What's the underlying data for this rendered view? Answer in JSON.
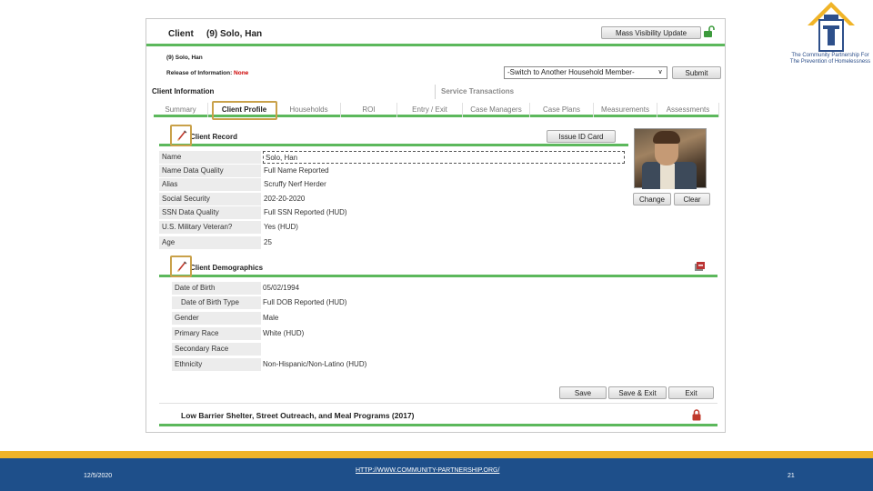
{
  "header": {
    "client_label": "Client",
    "client_name": "(9) Solo, Han",
    "mass_visibility_button": "Mass Visibility Update",
    "sub_name": "(9) Solo, Han",
    "roi_label": "Release of Information:",
    "roi_value": "None",
    "household_select": "-Switch to Another Household Member-",
    "submit_button": "Submit"
  },
  "outer_tabs": [
    {
      "label": "Client Information"
    },
    {
      "label": "Service Transactions"
    }
  ],
  "inner_tabs": [
    {
      "label": "Summary"
    },
    {
      "label": "Client Profile"
    },
    {
      "label": "Households"
    },
    {
      "label": "ROI"
    },
    {
      "label": "Entry / Exit"
    },
    {
      "label": "Case Managers"
    },
    {
      "label": "Case Plans"
    },
    {
      "label": "Measurements"
    },
    {
      "label": "Assessments"
    }
  ],
  "client_record": {
    "title": "Client Record",
    "issue_id_button": "Issue ID Card",
    "rows": [
      {
        "label": "Name",
        "value": "Solo, Han"
      },
      {
        "label": "Name Data Quality",
        "value": "Full Name Reported"
      },
      {
        "label": "Alias",
        "value": "Scruffy Nerf Herder"
      },
      {
        "label": "Social Security",
        "value": "202-20-2020"
      },
      {
        "label": "SSN Data Quality",
        "value": "Full SSN Reported (HUD)"
      },
      {
        "label": "U.S. Military Veteran?",
        "value": "Yes (HUD)"
      },
      {
        "label": "Age",
        "value": "25"
      }
    ],
    "change_button": "Change",
    "clear_button": "Clear"
  },
  "client_demographics": {
    "title": "Client Demographics",
    "rows": [
      {
        "label": "Date of Birth",
        "value": "05/02/1994"
      },
      {
        "label": "Date of Birth Type",
        "value": "Full DOB Reported (HUD)"
      },
      {
        "label": "Gender",
        "value": "Male"
      },
      {
        "label": "Primary Race",
        "value": "White (HUD)"
      },
      {
        "label": "Secondary Race",
        "value": ""
      },
      {
        "label": "Ethnicity",
        "value": "Non-Hispanic/Non-Latino (HUD)"
      }
    ],
    "save_button": "Save",
    "save_exit_button": "Save & Exit",
    "exit_button": "Exit"
  },
  "low_barrier": {
    "title": "Low Barrier Shelter, Street Outreach, and Meal Programs (2017)"
  },
  "logo": {
    "text": "The Community Partnership For The Prevention of Homelessness"
  },
  "footer": {
    "date": "12/5/2020",
    "url": "HTTP://WWW.COMMUNITY-PARTNERSHIP.ORG/",
    "page_number": "21"
  },
  "colors": {
    "accent_green": "#5cb85c",
    "highlight_gold": "#c9a14a",
    "footer_gold": "#f0b428",
    "footer_blue": "#1e4f8a",
    "roi_red": "#cc0000"
  }
}
